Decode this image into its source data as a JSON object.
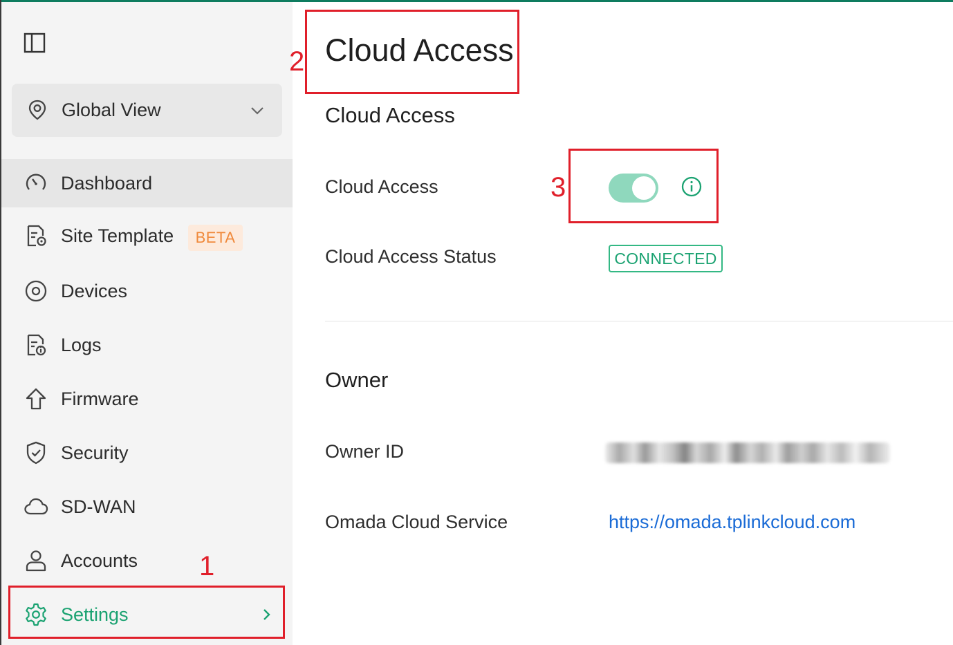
{
  "sidebar": {
    "site_selector": {
      "label": "Global View",
      "icon": "location-pin-icon"
    },
    "items": [
      {
        "label": "Dashboard",
        "icon": "dashboard-gauge-icon"
      },
      {
        "label": "Site Template",
        "icon": "site-template-icon",
        "badge": "BETA"
      },
      {
        "label": "Devices",
        "icon": "devices-icon"
      },
      {
        "label": "Logs",
        "icon": "logs-icon"
      },
      {
        "label": "Firmware",
        "icon": "firmware-upgrade-icon"
      },
      {
        "label": "Security",
        "icon": "shield-icon"
      },
      {
        "label": "SD-WAN",
        "icon": "cloud-icon"
      },
      {
        "label": "Accounts",
        "icon": "user-icon"
      },
      {
        "label": "Settings",
        "icon": "gear-icon"
      }
    ]
  },
  "page": {
    "title": "Cloud Access",
    "section_title": "Cloud Access",
    "cloud_access_label": "Cloud Access",
    "cloud_access_enabled": true,
    "status_label": "Cloud Access Status",
    "status_value": "CONNECTED",
    "owner_section_title": "Owner",
    "owner_id_label": "Owner ID",
    "omada_service_label": "Omada Cloud Service",
    "omada_service_link": "https://omada.tplinkcloud.com"
  },
  "annotations": {
    "one": "1",
    "two": "2",
    "three": "3"
  },
  "colors": {
    "accent_green": "#1aa271",
    "toggle_on": "#8fd8bd",
    "annotation_red": "#e01f2a",
    "beta_orange": "#f08a3c",
    "link_blue": "#1a6bd6"
  }
}
